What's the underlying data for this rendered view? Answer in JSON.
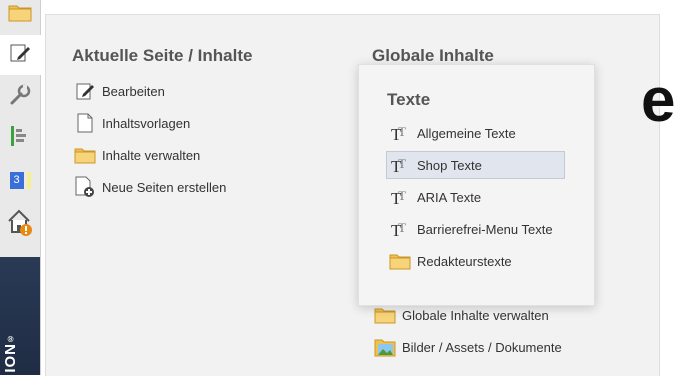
{
  "sidebar": {
    "brand_text": "ION",
    "brand_mark": "®",
    "items": [
      {
        "name": "folder-icon"
      },
      {
        "name": "edit-icon",
        "active": true
      },
      {
        "name": "wrench-icon"
      },
      {
        "name": "structure-icon"
      },
      {
        "name": "badge-icon",
        "badge": "3"
      },
      {
        "name": "home-warning-icon"
      }
    ]
  },
  "left_column": {
    "title": "Aktuelle Seite / Inhalte",
    "links": [
      {
        "label": "Bearbeiten",
        "icon": "pencil-icon"
      },
      {
        "label": "Inhaltsvorlagen",
        "icon": "page-icon"
      },
      {
        "label": "Inhalte verwalten",
        "icon": "folder-icon"
      },
      {
        "label": "Neue Seiten erstellen",
        "icon": "new-page-icon"
      }
    ]
  },
  "right_column": {
    "title": "Globale Inhalte",
    "links": [
      {
        "label": "Globale Inhalte verwalten",
        "icon": "folder-icon"
      },
      {
        "label": "Bilder / Assets / Dokumente",
        "icon": "image-icon"
      }
    ]
  },
  "background_text": "e",
  "popup": {
    "title": "Texte",
    "items": [
      {
        "label": "Allgemeine Texte",
        "icon": "text-icon"
      },
      {
        "label": "Shop Texte",
        "icon": "text-icon",
        "selected": true
      },
      {
        "label": "ARIA Texte",
        "icon": "text-icon"
      },
      {
        "label": "Barrierefrei-Menu Texte",
        "icon": "text-icon"
      },
      {
        "label": "Redakteurstexte",
        "icon": "folder-icon"
      }
    ]
  },
  "colors": {
    "accent_blue": "#3b6fd8",
    "folder_yellow": "#f3c14b",
    "warning_orange": "#e88a12",
    "structure_green": "#3da23d"
  }
}
